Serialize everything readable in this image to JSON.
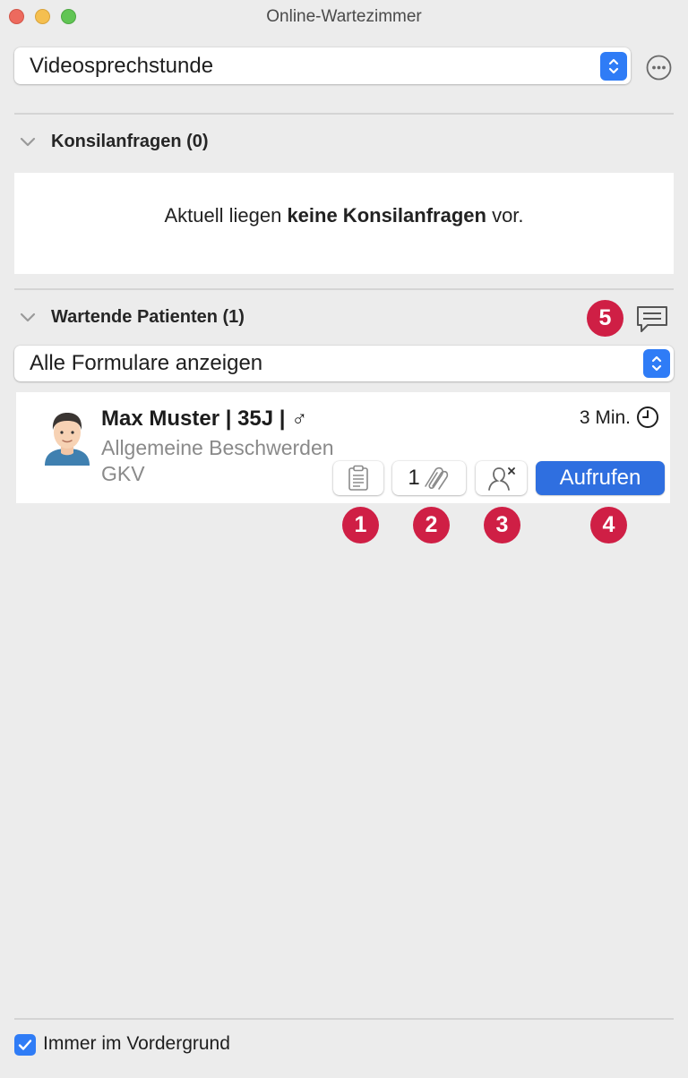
{
  "window": {
    "title": "Online-Wartezimmer"
  },
  "mode_select": {
    "value": "Videosprechstunde"
  },
  "consult_section": {
    "header": "Konsilanfragen (0)",
    "empty_prefix": "Aktuell liegen ",
    "empty_bold": "keine Konsilanfragen",
    "empty_suffix": " vor."
  },
  "waiting_section": {
    "header": "Wartende Patienten (1)",
    "message_badge": "5",
    "filter_select": {
      "value": "Alle Formulare anzeigen"
    }
  },
  "patient": {
    "name": "Max Muster | 35J | ",
    "gender_symbol": "♂",
    "reason": "Allgemeine Beschwerden",
    "insurance": "GKV",
    "wait_time": "3 Min.",
    "attachments_count": "1",
    "call_label": "Aufrufen"
  },
  "badges": [
    "1",
    "2",
    "3",
    "4"
  ],
  "footer": {
    "always_on_top_label": "Immer im Vordergrund",
    "always_on_top_checked": true
  },
  "colors": {
    "accent": "#2f7cf6",
    "badge": "#cf1f45",
    "call_button": "#2f6fe0"
  }
}
